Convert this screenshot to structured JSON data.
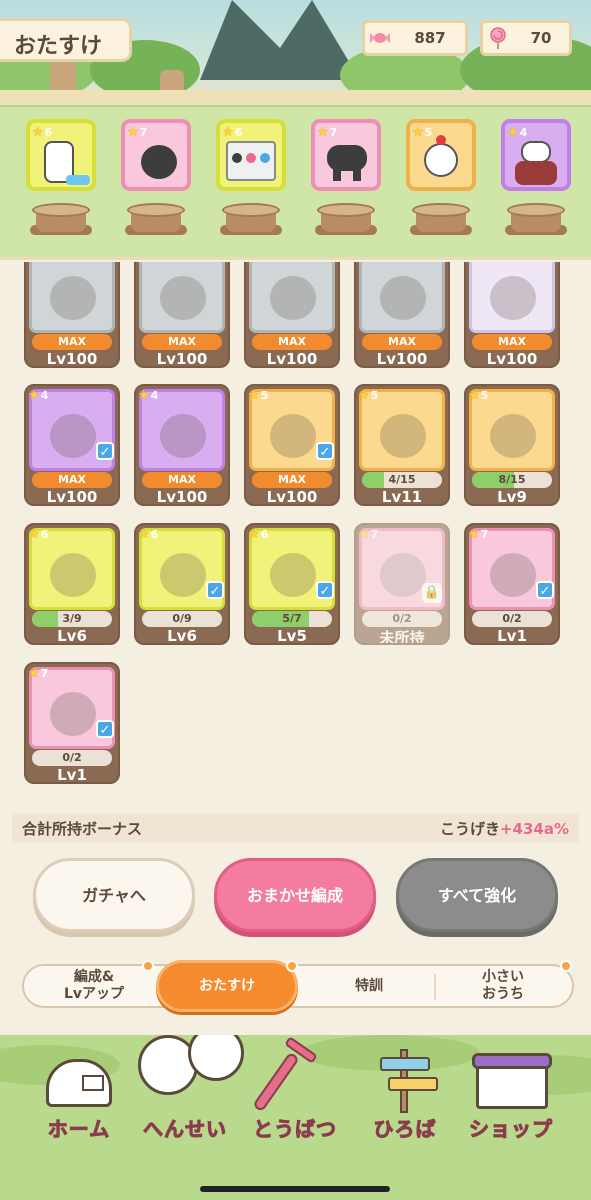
{
  "header": {
    "title": "おたすけ",
    "candy_count": "887",
    "lollipop_count": "70"
  },
  "party": [
    {
      "star": "6",
      "rarity": "r6"
    },
    {
      "star": "7",
      "rarity": "r7"
    },
    {
      "star": "6",
      "rarity": "r6"
    },
    {
      "star": "7",
      "rarity": "r7"
    },
    {
      "star": "5",
      "rarity": "r5"
    },
    {
      "star": "4",
      "rarity": "r4"
    }
  ],
  "cards": [
    {
      "row": 0,
      "col": 0,
      "star": "",
      "rarity": "rb",
      "bar": "MAX",
      "max": true,
      "lv": "Lv100",
      "checked": false
    },
    {
      "row": 0,
      "col": 1,
      "star": "",
      "rarity": "rb",
      "bar": "MAX",
      "max": true,
      "lv": "Lv100",
      "checked": false
    },
    {
      "row": 0,
      "col": 2,
      "star": "",
      "rarity": "rb",
      "bar": "MAX",
      "max": true,
      "lv": "Lv100",
      "checked": false
    },
    {
      "row": 0,
      "col": 3,
      "star": "",
      "rarity": "rb",
      "bar": "MAX",
      "max": true,
      "lv": "Lv100",
      "checked": false
    },
    {
      "row": 0,
      "col": 4,
      "star": "",
      "rarity": "rp",
      "bar": "MAX",
      "max": true,
      "lv": "Lv100",
      "checked": false
    },
    {
      "row": 1,
      "col": 0,
      "star": "4",
      "rarity": "r4",
      "bar": "MAX",
      "max": true,
      "lv": "Lv100",
      "checked": true
    },
    {
      "row": 1,
      "col": 1,
      "star": "4",
      "rarity": "r4",
      "bar": "MAX",
      "max": true,
      "lv": "Lv100",
      "checked": false
    },
    {
      "row": 1,
      "col": 2,
      "star": "5",
      "rarity": "r5",
      "bar": "MAX",
      "max": true,
      "lv": "Lv100",
      "checked": true
    },
    {
      "row": 1,
      "col": 3,
      "star": "5",
      "rarity": "r5",
      "bar": "4/15",
      "fill": 0.267,
      "lv": "Lv11",
      "checked": false
    },
    {
      "row": 1,
      "col": 4,
      "star": "5",
      "rarity": "r5",
      "bar": "8/15",
      "fill": 0.533,
      "lv": "Lv9",
      "checked": false
    },
    {
      "row": 2,
      "col": 0,
      "star": "6",
      "rarity": "r6",
      "bar": "3/9",
      "fill": 0.333,
      "lv": "Lv6",
      "checked": false
    },
    {
      "row": 2,
      "col": 1,
      "star": "6",
      "rarity": "r6",
      "bar": "0/9",
      "fill": 0,
      "lv": "Lv6",
      "checked": true
    },
    {
      "row": 2,
      "col": 2,
      "star": "6",
      "rarity": "r6",
      "bar": "5/7",
      "fill": 0.714,
      "lv": "Lv5",
      "checked": true
    },
    {
      "row": 2,
      "col": 3,
      "star": "7",
      "rarity": "r7",
      "bar": "0/2",
      "fill": 0,
      "lv": "未所持",
      "checked": false,
      "locked": true
    },
    {
      "row": 2,
      "col": 4,
      "star": "7",
      "rarity": "r7",
      "bar": "0/2",
      "fill": 0,
      "lv": "Lv1",
      "checked": true
    },
    {
      "row": 3,
      "col": 0,
      "star": "7",
      "rarity": "r7",
      "bar": "0/2",
      "fill": 0,
      "lv": "Lv1",
      "checked": true
    }
  ],
  "bonus": {
    "label": "合計所持ボーナス",
    "stat": "こうげき",
    "value": "+434a%"
  },
  "buttons": {
    "gacha": "ガチャへ",
    "auto": "おまかせ編成",
    "upgrade": "すべて強化"
  },
  "subtabs": {
    "formation_line1": "編成&",
    "formation_line2": "Lvアップ",
    "otasuke": "おたすけ",
    "training": "特訓",
    "house_line1": "小さい",
    "house_line2": "おうち"
  },
  "nav": {
    "home": "ホーム",
    "formation": "へんせい",
    "battle": "とうばつ",
    "plaza": "ひろば",
    "shop": "ショップ"
  },
  "colors": {
    "accent_orange": "#f58a2e",
    "accent_pink": "#f37ca0",
    "bonus_value": "#e86a8c",
    "nav_label": "#ff6f8f"
  }
}
